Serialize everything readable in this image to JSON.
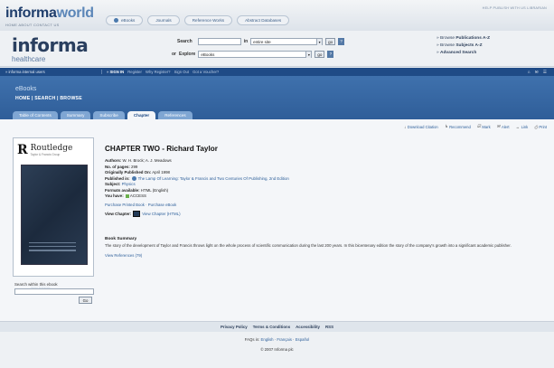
{
  "header": {
    "logo_light": "informa",
    "logo_bold": "world",
    "logo_sub": "HOME  ABOUT  CONTACT US",
    "top_right": "HELP  PUBLISH WITH US  LIBRARIAN",
    "top_tabs": [
      "eBooks",
      "Journals",
      "Reference Works",
      "Abstract Databases"
    ]
  },
  "brand": {
    "name": "informa",
    "sub": "healthcare"
  },
  "search": {
    "search_label": "Search",
    "in_label": "in",
    "scope_value": "entire site",
    "or_label": "or",
    "explore_label": "Explore",
    "explore_value": "eBooks",
    "go_label": "go",
    "help_label": "?"
  },
  "browse": {
    "items": [
      {
        "prefix": "Browse",
        "bold": "Publications A-Z"
      },
      {
        "prefix": "Browse",
        "bold": "Subjects A-Z"
      },
      {
        "prefix": "",
        "bold": "Advanced Search"
      }
    ]
  },
  "navbar": {
    "internal": "informa internal users",
    "signin": "SIGN IN",
    "register": "Register",
    "why": "Why Register?",
    "signout": "Sign Out",
    "voucher": "Got a Voucher?",
    "icons": "⌂ ✉ ☰"
  },
  "product": {
    "title": "eBooks",
    "sub": "HOME  |  SEARCH  |  BROWSE",
    "tabs": [
      "Table of Contents",
      "Summary",
      "Subscribe",
      "Chapter",
      "References"
    ],
    "active_tab": 3
  },
  "actions": [
    {
      "icon": "↓",
      "label": "Download Citation"
    },
    {
      "icon": "↳",
      "label": "Recommend"
    },
    {
      "icon": "☑",
      "label": "Mark"
    },
    {
      "icon": "✉",
      "label": "Alert"
    },
    {
      "icon": "↔",
      "label": "Link"
    },
    {
      "icon": "⎙",
      "label": "Print"
    }
  ],
  "book": {
    "publisher": "Routledge",
    "publisher_tag": "Taylor & Francis Group",
    "cover_caption": "Taylor & Francis",
    "search_within_label": "Search within this ebook",
    "go_label": "Go"
  },
  "chapter": {
    "title": "CHAPTER TWO - Richard Taylor",
    "authors_label": "Authors:",
    "authors": "W. H. Brock; A. J. Meadows",
    "pages_label": "No. of pages:",
    "pages": "299",
    "published_label": "Originally Published On:",
    "published": "April 1998",
    "published_in_label": "Published in:",
    "published_in": "The Lamp Of Learning: Taylor & Francis and Two Centuries Of Publishing, 2nd Edition",
    "subject_label": "Subject:",
    "subject": "Physics",
    "formats_label": "Formats available:",
    "formats": "HTML (English)",
    "access_label": "You have:",
    "access": "ACCESS",
    "purchase_print": "Purchase Printed Book",
    "purchase_ebook": "Purchase eBook",
    "view_label": "View Chapter:",
    "view_link": "View Chapter (HTML)",
    "summary_heading": "Book Summary",
    "summary_text": "The story of the development of Taylor and Francis throws light on the whole process of scientific communication during the last 200 years. In this bicentenary edition the story of the company's growth into a significant academic publisher.",
    "view_refs": "View References (79)"
  },
  "footer": {
    "links": [
      "Privacy Policy",
      "Terms & Conditions",
      "Accessibility",
      "RSS"
    ],
    "faq_prefix": "FAQs in:",
    "faq_langs": [
      "English",
      "Français",
      "Español"
    ],
    "copyright": "© 2007 Informa plc"
  }
}
